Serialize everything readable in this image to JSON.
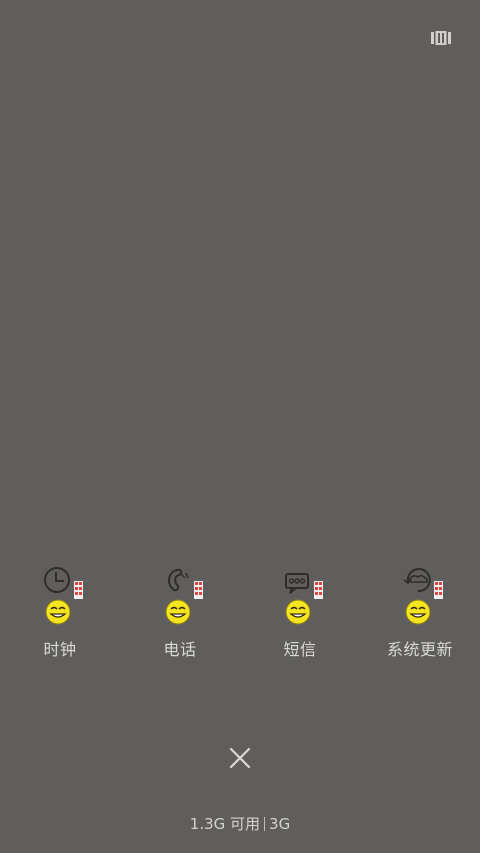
{
  "top_bar": {
    "layout_toggle_icon": "layout-toggle-icon"
  },
  "recent_apps": [
    {
      "label": "时钟",
      "icon": "clock-icon",
      "badge_icon": "smiley-face-icon"
    },
    {
      "label": "电话",
      "icon": "phone-icon",
      "badge_icon": "smiley-face-icon"
    },
    {
      "label": "短信",
      "icon": "message-icon",
      "badge_icon": "smiley-face-icon"
    },
    {
      "label": "系统更新",
      "icon": "system-update-icon",
      "badge_icon": "smiley-face-icon"
    }
  ],
  "close_button": {
    "icon": "close-icon"
  },
  "memory": {
    "available": "1.3G 可用",
    "total": "3G"
  },
  "colors": {
    "background": "#5f5e5c",
    "label_text": "#d9d8d5",
    "badge_yellow": "#f5e51f",
    "stamp_red": "#e0463f"
  }
}
